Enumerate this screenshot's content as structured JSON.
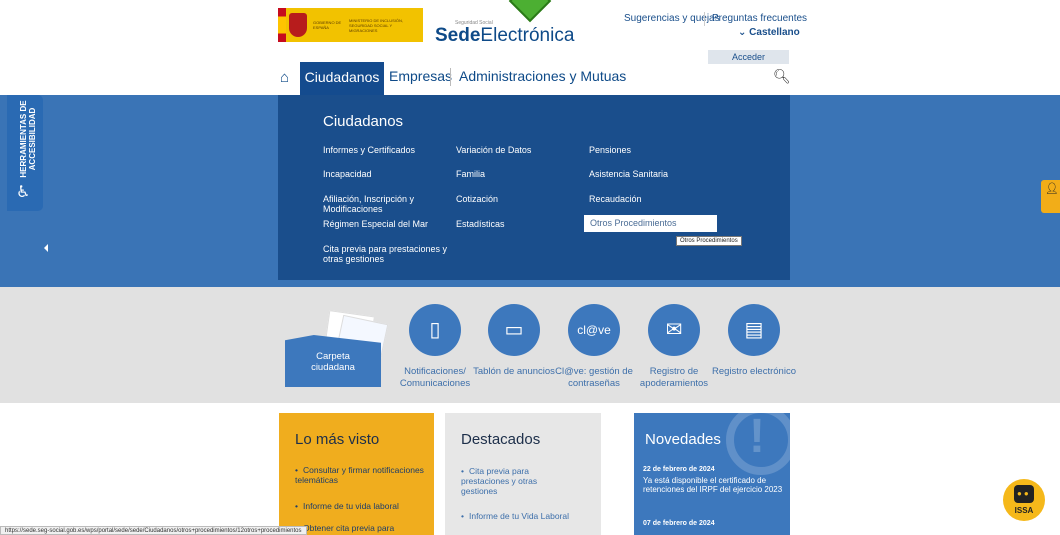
{
  "header": {
    "gov_text_1": "GOBIERNO DE ESPAÑA",
    "gov_text_2": "MINISTERIO DE INCLUSIÓN, SEGURIDAD SOCIAL Y MIGRACIONES",
    "sede_subtitle": "Seguridad Social",
    "sede_bold": "Sede",
    "sede_rest": "Electrónica",
    "link_sugerencias": "Sugerencias y quejas",
    "link_faq": "Preguntas frecuentes",
    "language": "⌄ Castellano",
    "login": "Acceder"
  },
  "nav": {
    "tabs": [
      "Ciudadanos",
      "Empresas",
      "Administraciones y Mutuas"
    ],
    "home_icon": "home-icon",
    "search_icon": "search-icon"
  },
  "mega_menu": {
    "title": "Ciudadanos",
    "col1": [
      "Informes y Certificados",
      "Incapacidad",
      "Afiliación, Inscripción y Modificaciones",
      "Régimen Especial del Mar",
      "Cita previa para prestaciones y otras gestiones"
    ],
    "col2": [
      "Variación de Datos",
      "Familia",
      "Cotización",
      "Estadísticas"
    ],
    "col3": [
      "Pensiones",
      "Asistencia Sanitaria",
      "Recaudación",
      "Otros Procedimientos"
    ],
    "tooltip": "Otros Procedimientos"
  },
  "accessibility": {
    "label": "HERRAMIENTAS DE ACCESIBILIDAD"
  },
  "services": {
    "carpeta": "Carpeta ciudadana",
    "items": [
      {
        "label": "Notificaciones/ Comunicaciones",
        "icon": "notification-icon"
      },
      {
        "label": "Tablón de anuncios",
        "icon": "board-icon"
      },
      {
        "label": "Cl@ve: gestión de contraseñas",
        "icon": "clave-icon"
      },
      {
        "label": "Registro de apoderamientos",
        "icon": "envelope-icon"
      },
      {
        "label": "Registro electrónico",
        "icon": "document-icon"
      }
    ],
    "clave_text": "cl@ve"
  },
  "cards": {
    "mas_visto": {
      "title": "Lo más visto",
      "items": [
        "Consultar y firmar notificaciones telemáticas",
        "Informe de tu vida laboral",
        "Obtener cita previa para"
      ],
      "color": "#f0ad1e"
    },
    "destacados": {
      "title": "Destacados",
      "items": [
        "Cita previa para prestaciones y otras gestiones",
        "Informe de tu Vida Laboral"
      ],
      "color": "#e7e7e7"
    },
    "novedades": {
      "title": "Novedades",
      "news": [
        {
          "date": "22 de febrero de 2024",
          "text": "Ya está disponible el certificado de retenciones del IRPF del ejercicio 2023"
        },
        {
          "date": "07 de febrero de 2024",
          "text": ""
        }
      ],
      "color": "#3d78bd"
    }
  },
  "status_url": "https://sede.seg-social.gob.es/wps/portal/sede/sede/Ciudadanos/otros+procedimientos/12otros+procedimientos",
  "chatbot": "ISSA"
}
